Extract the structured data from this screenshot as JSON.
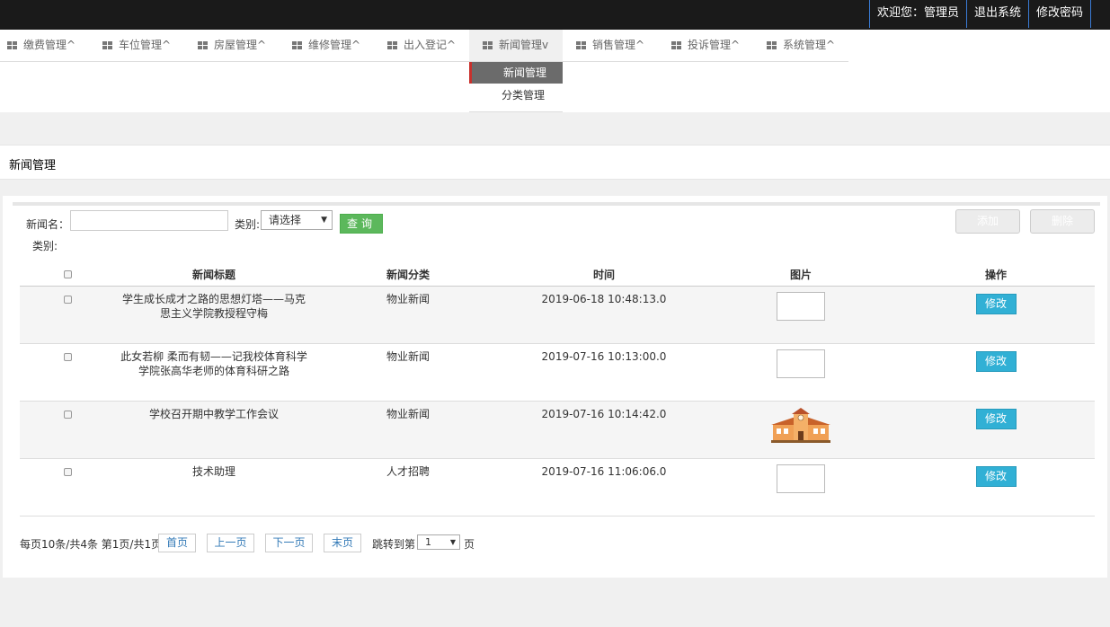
{
  "topbar": {
    "welcome": "欢迎您：管理员",
    "logout": "退出系统",
    "change_password": "修改密码"
  },
  "nav": {
    "items": [
      {
        "label": "缴费管理^",
        "icon": "grid-icon"
      },
      {
        "label": "车位管理^",
        "icon": "grid-icon"
      },
      {
        "label": "房屋管理^",
        "icon": "grid-icon"
      },
      {
        "label": "维修管理^",
        "icon": "grid-icon"
      },
      {
        "label": "出入登记^",
        "icon": "grid-icon"
      },
      {
        "label": "新闻管理v",
        "icon": "grid-icon"
      },
      {
        "label": "销售管理^",
        "icon": "grid-icon"
      },
      {
        "label": "投诉管理^",
        "icon": "grid-icon"
      },
      {
        "label": "系统管理^",
        "icon": "grid-icon"
      }
    ],
    "dropdown": [
      "新闻管理",
      "分类管理"
    ]
  },
  "page_title": "新闻管理",
  "search": {
    "name_label": "新闻名：",
    "name_value": "",
    "category_label": "类别:",
    "category_value": "请选择",
    "query_button": "查询",
    "category_label2": "类别:"
  },
  "actions": {
    "add": "添加",
    "delete": "删除"
  },
  "table": {
    "headers": [
      "",
      "新闻标题",
      "新闻分类",
      "时间",
      "图片",
      "操作"
    ],
    "rows": [
      {
        "title": "学生成长成才之路的思想灯塔——马克思主义学院教授程守梅",
        "category": "物业新闻",
        "time": "2019-06-18 10:48:13.0",
        "image": "broken-image",
        "action": "修改"
      },
      {
        "title": "此女若柳 柔而有韧——记我校体育科学学院张高华老师的体育科研之路",
        "category": "物业新闻",
        "time": "2019-07-16 10:13:00.0",
        "image": "broken-image",
        "action": "修改"
      },
      {
        "title": "学校召开期中教学工作会议",
        "category": "物业新闻",
        "time": "2019-07-16 10:14:42.0",
        "image": "school-building",
        "action": "修改"
      },
      {
        "title": "技术助理",
        "category": "人才招聘",
        "time": "2019-07-16 11:06:06.0",
        "image": "broken-image",
        "action": "修改"
      }
    ]
  },
  "pager": {
    "summary": "每页10条/共4条 第1页/共1页",
    "first": "首页",
    "prev": "上一页",
    "next": "下一页",
    "last": "末页",
    "jump_label": "跳转到第",
    "jump_value": "1",
    "jump_suffix": "页"
  },
  "colors": {
    "topbar": "#1a1a1a",
    "query_button": "#5cb85c",
    "edit_button": "#31b0d5",
    "active_menu": "#6b6b6b",
    "accent_red": "#c9302c"
  }
}
